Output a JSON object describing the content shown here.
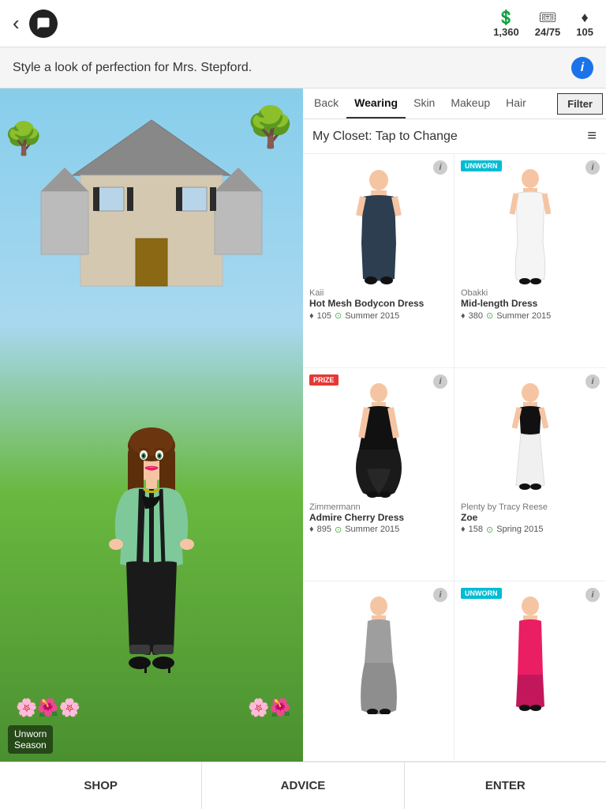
{
  "topBar": {
    "backLabel": "‹",
    "currency1": {
      "icon": "💲",
      "value": "1,360"
    },
    "currency2": {
      "icon": "🎟",
      "value": "24/75"
    },
    "currency3": {
      "icon": "♦",
      "value": "105"
    }
  },
  "missionBar": {
    "text": "Style a look of perfection for Mrs. Stepford."
  },
  "tabs": [
    {
      "id": "back",
      "label": "Back"
    },
    {
      "id": "wearing",
      "label": "Wearing"
    },
    {
      "id": "skin",
      "label": "Skin"
    },
    {
      "id": "makeup",
      "label": "Makeup"
    },
    {
      "id": "hair",
      "label": "Hair"
    }
  ],
  "filterLabel": "Filter",
  "closetTitle": "My Closet: Tap to Change",
  "avatarLabels": {
    "unworn": "Unworn",
    "season": "Season"
  },
  "items": [
    {
      "brand": "Kaii",
      "name": "Hot Mesh Bodycon Dress",
      "diamond": "105",
      "season": "Summer 2015",
      "badge": null,
      "color1": "#2c3e50",
      "color2": "#1a252f",
      "dressType": "mini"
    },
    {
      "brand": "Obakki",
      "name": "Mid-length Dress",
      "diamond": "380",
      "season": "Summer 2015",
      "badge": "UNWORN",
      "badgeType": "unworn",
      "color1": "#f5f5f5",
      "color2": "#e0e0e0",
      "dressType": "midi-white"
    },
    {
      "brand": "Zimmermann",
      "name": "Admire Cherry Dress",
      "diamond": "895",
      "season": "Summer 2015",
      "badge": "PRIZE",
      "badgeType": "prize",
      "color1": "#111",
      "color2": "#333",
      "dressType": "maxi-black"
    },
    {
      "brand": "Plenty by Tracy Reese",
      "name": "Zoe",
      "diamond": "158",
      "season": "Spring 2015",
      "badge": null,
      "color1": "#111",
      "color2": "#f0f0f0",
      "dressType": "skirt-white"
    },
    {
      "brand": "",
      "name": "",
      "diamond": "",
      "season": "",
      "badge": null,
      "color1": "#9e9e9e",
      "dressType": "maxi-grey"
    },
    {
      "brand": "",
      "name": "",
      "diamond": "",
      "season": "",
      "badge": "UNWORN",
      "badgeType": "unworn",
      "color1": "#e91e63",
      "dressType": "mini-pink"
    }
  ],
  "bottomNav": [
    {
      "id": "shop",
      "label": "SHOP"
    },
    {
      "id": "advice",
      "label": "ADVICE"
    },
    {
      "id": "enter",
      "label": "ENTER"
    }
  ]
}
